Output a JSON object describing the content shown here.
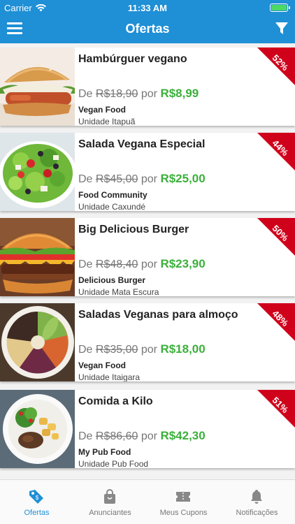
{
  "status_bar": {
    "carrier": "Carrier",
    "time": "11:33 AM"
  },
  "header": {
    "title": "Ofertas"
  },
  "offers": [
    {
      "name": "Hambúrguer vegano",
      "de_label": "De",
      "old_price": "R$18,90",
      "por_label": "por",
      "new_price": "R$8,99",
      "store": "Vegan Food",
      "unit": "Unidade Itapuã",
      "discount": "52%",
      "image": "vegan-burger-photo"
    },
    {
      "name": "Salada Vegana Especial",
      "de_label": "De",
      "old_price": "R$45,00",
      "por_label": "por",
      "new_price": "R$25,00",
      "store": "Food Community",
      "unit": "Unidade Caxundé",
      "discount": "44%",
      "image": "salad-photo"
    },
    {
      "name": "Big Delicious Burger",
      "de_label": "De",
      "old_price": "R$48,40",
      "por_label": "por",
      "new_price": "R$23,90",
      "store": "Delicious Burger",
      "unit": "Unidade Mata Escura",
      "discount": "50%",
      "image": "burger-photo"
    },
    {
      "name": "Saladas Veganas para almoço",
      "de_label": "De",
      "old_price": "R$35,00",
      "por_label": "por",
      "new_price": "R$18,00",
      "store": "Vegan Food",
      "unit": "Unidade Itaigara",
      "discount": "48%",
      "image": "vegan-bowl-photo"
    },
    {
      "name": "Comida a Kilo",
      "de_label": "De",
      "old_price": "R$86,60",
      "por_label": "por",
      "new_price": "R$42,30",
      "store": "My Pub Food",
      "unit": "Unidade Pub Food",
      "discount": "51%",
      "image": "plate-food-photo"
    }
  ],
  "tabs": [
    {
      "label": "Ofertas",
      "icon": "price-tag-icon",
      "active": true
    },
    {
      "label": "Anunciantes",
      "icon": "shopping-bag-icon",
      "active": false
    },
    {
      "label": "Meus Cupons",
      "icon": "ticket-icon",
      "active": false
    },
    {
      "label": "Notificações",
      "icon": "bell-icon",
      "active": false
    }
  ],
  "colors": {
    "primary": "#1f8fd6",
    "price_green": "#3bb03b",
    "ribbon_red": "#d0021b",
    "tab_inactive": "#777777"
  }
}
